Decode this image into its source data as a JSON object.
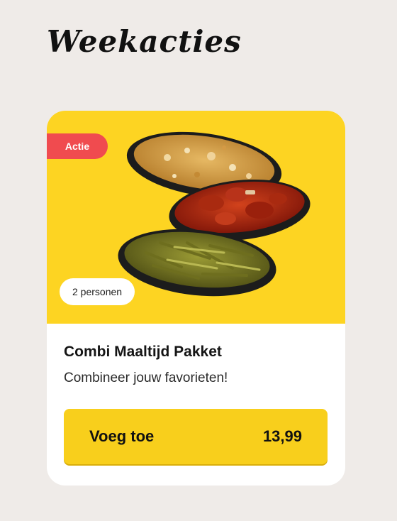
{
  "section": {
    "title": "Weekacties"
  },
  "product": {
    "badge_label": "Actie",
    "persons_label": "2 personen",
    "name": "Combi Maaltijd Pakket",
    "description": "Combineer jouw favorieten!",
    "add_label": "Voeg toe",
    "price": "13,99",
    "image_dishes": [
      "fried-rice",
      "sweet-sour-chicken",
      "green-beans"
    ]
  },
  "colors": {
    "page_background": "#efebe8",
    "card_background": "#ffffff",
    "media_background": "#fdd422",
    "badge_red": "#f04b4f",
    "button_yellow": "#f8cf1c"
  }
}
